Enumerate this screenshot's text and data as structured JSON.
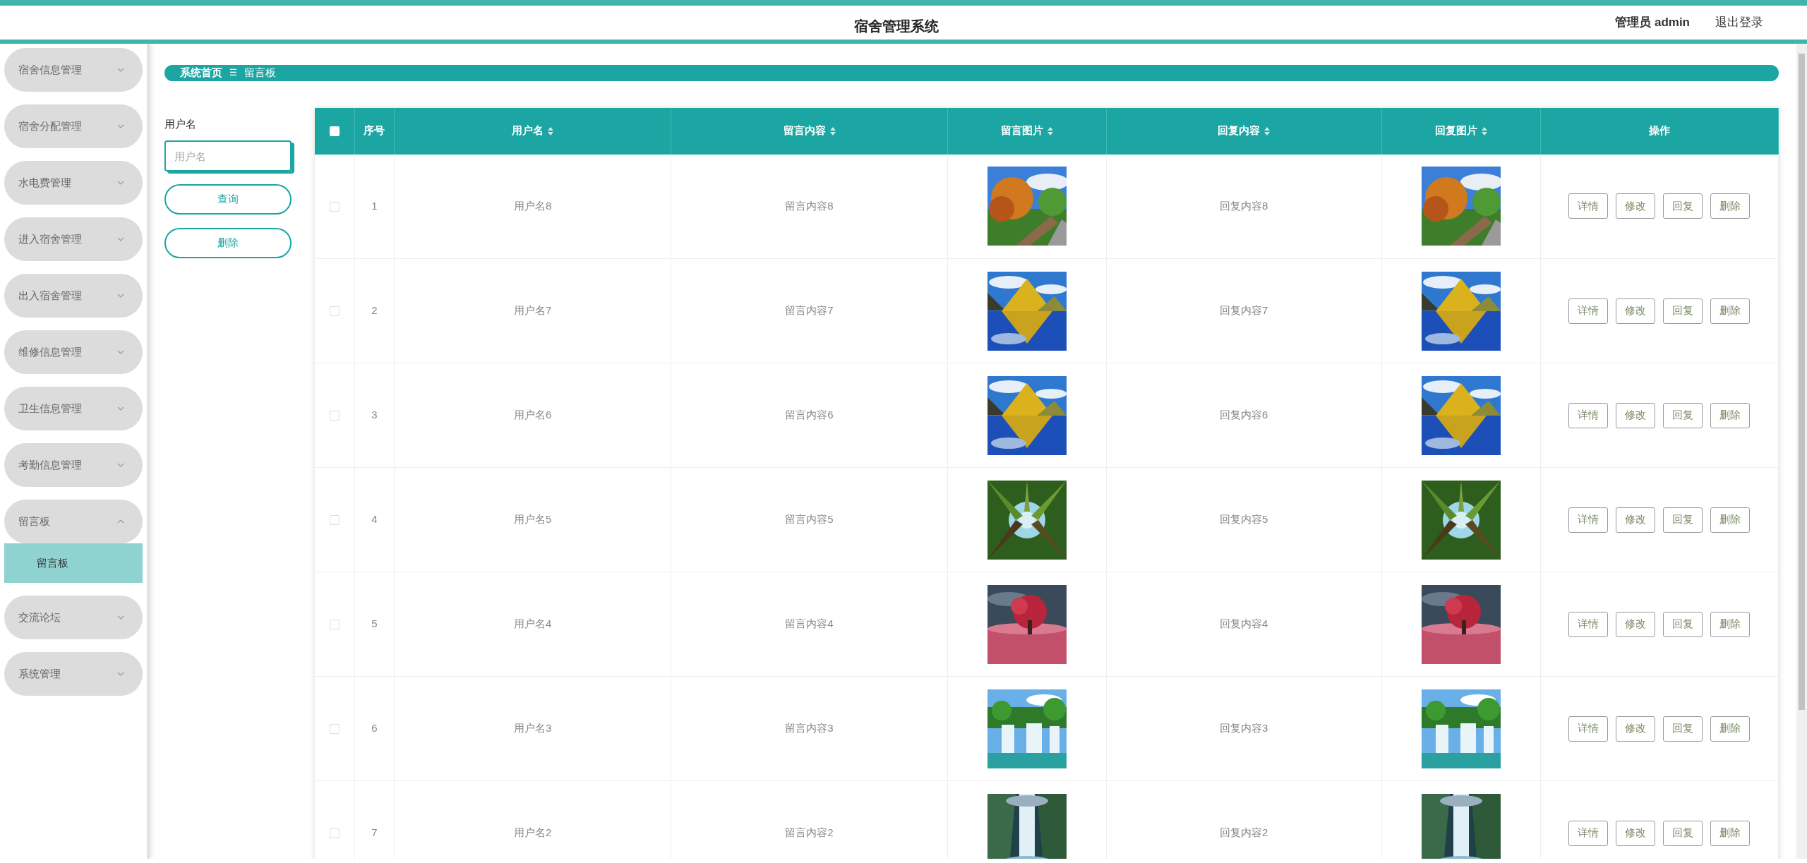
{
  "header": {
    "title": "宿舍管理系统",
    "user": "管理员 admin",
    "logout": "退出登录"
  },
  "sidebar": {
    "items": [
      {
        "label": "宿舍信息管理",
        "expanded": false
      },
      {
        "label": "宿舍分配管理",
        "expanded": false
      },
      {
        "label": "水电费管理",
        "expanded": false
      },
      {
        "label": "进入宿舍管理",
        "expanded": false
      },
      {
        "label": "出入宿舍管理",
        "expanded": false
      },
      {
        "label": "维修信息管理",
        "expanded": false
      },
      {
        "label": "卫生信息管理",
        "expanded": false
      },
      {
        "label": "考勤信息管理",
        "expanded": false
      },
      {
        "label": "留言板",
        "expanded": true,
        "children": [
          {
            "label": "留言板",
            "selected": true
          }
        ]
      },
      {
        "label": "交流论坛",
        "expanded": false
      },
      {
        "label": "系统管理",
        "expanded": false
      }
    ]
  },
  "breadcrumb": {
    "home": "系统首页",
    "separator": "☰",
    "current": "留言板"
  },
  "search": {
    "label": "用户名",
    "placeholder": "用户名",
    "buttons": [
      "查询",
      "删除"
    ]
  },
  "table": {
    "select_all_checked": false,
    "columns": [
      {
        "label": "序号",
        "sortable": false
      },
      {
        "label": "用户名",
        "sortable": true
      },
      {
        "label": "留言内容",
        "sortable": true
      },
      {
        "label": "留言图片",
        "sortable": true
      },
      {
        "label": "回复内容",
        "sortable": true
      },
      {
        "label": "回复图片",
        "sortable": true
      },
      {
        "label": "操作",
        "sortable": false
      }
    ],
    "rows": [
      {
        "checked": false,
        "index": "1",
        "username": "用户名8",
        "content": "留言内容8",
        "reply": "回复内容8",
        "actions": [
          "详情",
          "修改",
          "回复",
          "删除"
        ]
      },
      {
        "checked": false,
        "index": "2",
        "username": "用户名7",
        "content": "留言内容7",
        "reply": "回复内容7",
        "actions": [
          "详情",
          "修改",
          "回复",
          "删除"
        ]
      },
      {
        "checked": false,
        "index": "3",
        "username": "用户名6",
        "content": "留言内容6",
        "reply": "回复内容6",
        "actions": [
          "详情",
          "修改",
          "回复",
          "删除"
        ]
      },
      {
        "checked": false,
        "index": "4",
        "username": "用户名5",
        "content": "留言内容5",
        "reply": "回复内容5",
        "actions": [
          "详情",
          "修改",
          "回复",
          "删除"
        ]
      },
      {
        "checked": false,
        "index": "5",
        "username": "用户名4",
        "content": "留言内容4",
        "reply": "回复内容4",
        "actions": [
          "详情",
          "修改",
          "回复",
          "删除"
        ]
      },
      {
        "checked": false,
        "index": "6",
        "username": "用户名3",
        "content": "留言内容3",
        "reply": "回复内容3",
        "actions": [
          "详情",
          "修改",
          "回复",
          "删除"
        ]
      },
      {
        "checked": false,
        "index": "7",
        "username": "用户名2",
        "content": "留言内容2",
        "reply": "回复内容2",
        "actions": [
          "详情",
          "修改",
          "回复",
          "删除"
        ]
      }
    ]
  }
}
